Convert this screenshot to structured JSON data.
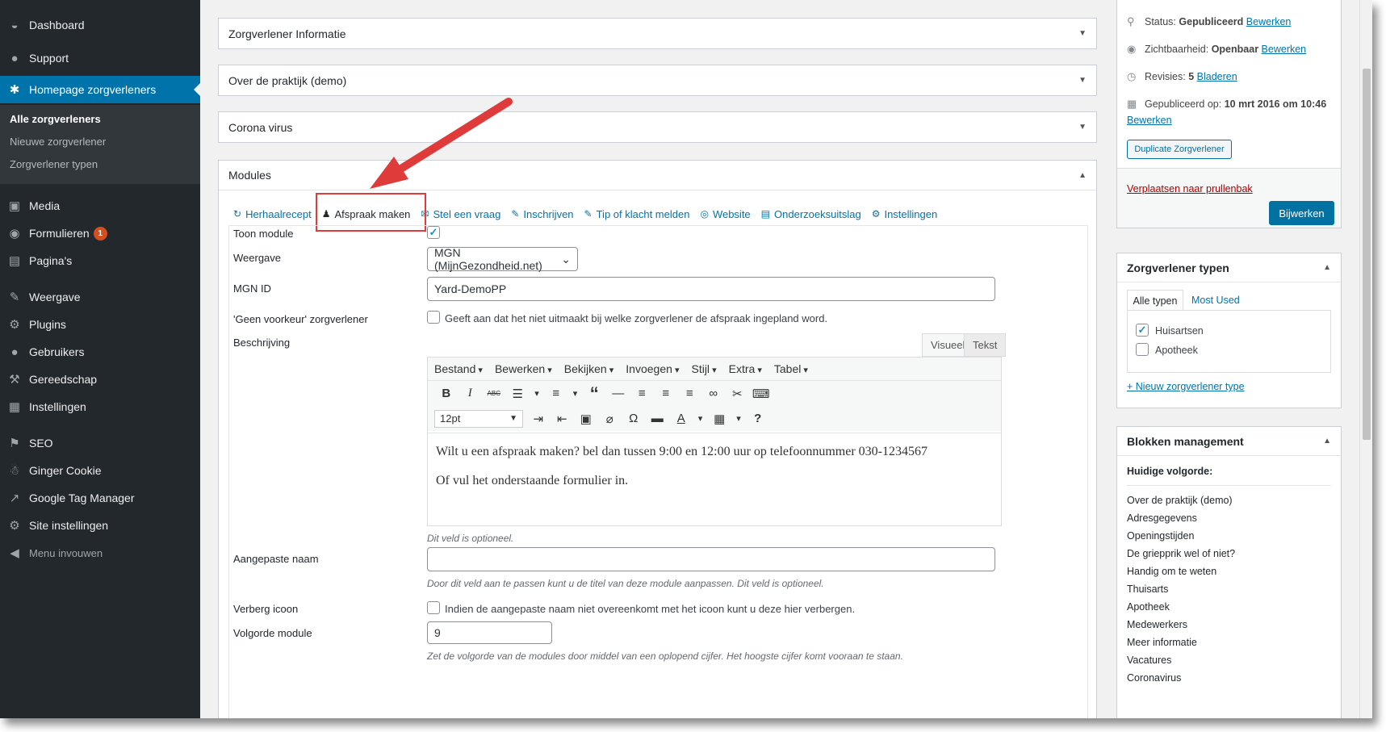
{
  "sidebar": {
    "items": [
      {
        "label": "Dashboard",
        "icon": "dashboard-icon",
        "glyph": "◒"
      },
      {
        "label": "Support",
        "icon": "lightbulb-icon",
        "glyph": "●"
      },
      {
        "label": "Homepage zorgverleners",
        "icon": "person-icon",
        "glyph": "✱"
      },
      {
        "label": "Media",
        "icon": "media-icon",
        "glyph": "▣"
      },
      {
        "label": "Formulieren",
        "icon": "forms-icon",
        "glyph": "◉",
        "badge": "1"
      },
      {
        "label": "Pagina's",
        "icon": "pages-icon",
        "glyph": "▤"
      },
      {
        "label": "Weergave",
        "icon": "brush-icon",
        "glyph": "✎"
      },
      {
        "label": "Plugins",
        "icon": "plugin-icon",
        "glyph": "⚙"
      },
      {
        "label": "Gebruikers",
        "icon": "users-icon",
        "glyph": "●"
      },
      {
        "label": "Gereedschap",
        "icon": "wrench-icon",
        "glyph": "⚒"
      },
      {
        "label": "Instellingen",
        "icon": "settings-icon",
        "glyph": "▦"
      },
      {
        "label": "SEO",
        "icon": "seo-icon",
        "glyph": "⚑"
      },
      {
        "label": "Ginger Cookie",
        "icon": "cookie-icon",
        "glyph": "☃"
      },
      {
        "label": "Google Tag Manager",
        "icon": "chart-icon",
        "glyph": "↗"
      },
      {
        "label": "Site instellingen",
        "icon": "gear-icon",
        "glyph": "⚙"
      },
      {
        "label": "Menu invouwen",
        "icon": "collapse-icon",
        "glyph": "◀"
      }
    ],
    "submenu": [
      "Alle zorgverleners",
      "Nieuwe zorgverlener",
      "Zorgverlener typen"
    ]
  },
  "main": {
    "boxes": [
      "Zorgverlener Informatie",
      "Over de praktijk (demo)",
      "Corona virus"
    ],
    "modules": {
      "title": "Modules",
      "tabs": [
        {
          "label": "Herhaalrecept",
          "glyph": "↻",
          "icon": "refresh-icon"
        },
        {
          "label": "Afspraak maken",
          "glyph": "♟",
          "icon": "person-icon"
        },
        {
          "label": "Stel een vraag",
          "glyph": "✉",
          "icon": "chat-icon"
        },
        {
          "label": "Inschrijven",
          "glyph": "✎",
          "icon": "pencil-icon"
        },
        {
          "label": "Tip of klacht melden",
          "glyph": "✎",
          "icon": "pencil-icon"
        },
        {
          "label": "Website",
          "glyph": "◎",
          "icon": "globe-icon"
        },
        {
          "label": "Onderzoeksuitslag",
          "glyph": "▤",
          "icon": "table-icon"
        },
        {
          "label": "Instellingen",
          "glyph": "⚙",
          "icon": "gear-icon"
        }
      ],
      "fields": {
        "toon_module": "Toon module",
        "weergave_label": "Weergave",
        "weergave_value": "MGN (MijnGezondheid.net)",
        "mgn_label": "MGN ID",
        "mgn_value": "Yard-DemoPP",
        "geen_label": "'Geen voorkeur' zorgverlener",
        "geen_text": "Geeft aan dat het niet uitmaakt bij welke zorgverlener de afspraak ingepland word.",
        "beschrijving_label": "Beschrijving",
        "optional_hint": "Dit veld is optioneel.",
        "aangepaste_label": "Aangepaste naam",
        "aangepaste_value": "",
        "aangepaste_hint": "Door dit veld aan te passen kunt u de titel van deze module aanpassen. Dit veld is optioneel.",
        "verberg_label": "Verberg icoon",
        "verberg_text": "Indien de aangepaste naam niet overeenkomt met het icoon kunt u deze hier verbergen.",
        "volgorde_label": "Volgorde module",
        "volgorde_value": "9",
        "volgorde_hint": "Zet de volgorde van de modules door middel van een oplopend cijfer. Het hoogste cijfer komt vooraan te staan."
      },
      "editor": {
        "tab_visual": "Visueel",
        "tab_text": "Tekst",
        "menus": [
          "Bestand",
          "Bewerken",
          "Bekijken",
          "Invoegen",
          "Stijl",
          "Extra",
          "Tabel"
        ],
        "font_size": "12pt",
        "toolbar1": [
          "B",
          "I",
          "ABC",
          "☰",
          "▾",
          "≡",
          "▾",
          "“",
          "—",
          "≡",
          "≡",
          "≡",
          "∞",
          "✂",
          "⌨"
        ],
        "toolbar2": [
          "⇥",
          "⇤",
          "▣",
          "⌀",
          "Ω",
          "▬",
          "A",
          "▾",
          "▦",
          "▾",
          "?"
        ],
        "paragraphs": [
          "Wilt u een afspraak maken? bel dan tussen 9:00 en 12:00 uur op telefoonnummer 030-1234567",
          "Of vul het onderstaande formulier in."
        ]
      }
    }
  },
  "publish": {
    "status_label": "Status:",
    "status_value": "Gepubliceerd",
    "visibility_label": "Zichtbaarheid:",
    "visibility_value": "Openbaar",
    "revisions_label": "Revisies:",
    "revisions_value": "5",
    "browse": "Bladeren",
    "published_label": "Gepubliceerd op:",
    "published_value": "10 mrt 2016 om 10:46",
    "edit": "Bewerken",
    "duplicate": "Duplicate Zorgverlener",
    "trash": "Verplaatsen naar prullenbak",
    "update": "Bijwerken"
  },
  "types": {
    "title": "Zorgverlener typen",
    "tab_all": "Alle typen",
    "tab_used": "Most Used",
    "items": [
      {
        "label": "Huisartsen",
        "checked": "✓"
      },
      {
        "label": "Apotheek",
        "checked": ""
      }
    ],
    "add_new": "+ Nieuw zorgverlener type"
  },
  "blocks": {
    "title": "Blokken management",
    "subtitle": "Huidige volgorde:",
    "items": [
      "Over de praktijk (demo)",
      "Adresgegevens",
      "Openingstijden",
      "De griepprik wel of niet?",
      "Handig om te weten",
      "Thuisarts",
      "Apotheek",
      "Medewerkers",
      "Meer informatie",
      "Vacatures",
      "Coronavirus"
    ]
  },
  "colors": {
    "accent": "#0073aa",
    "sidebar": "#23282d",
    "arrow": "#e03b3b"
  }
}
